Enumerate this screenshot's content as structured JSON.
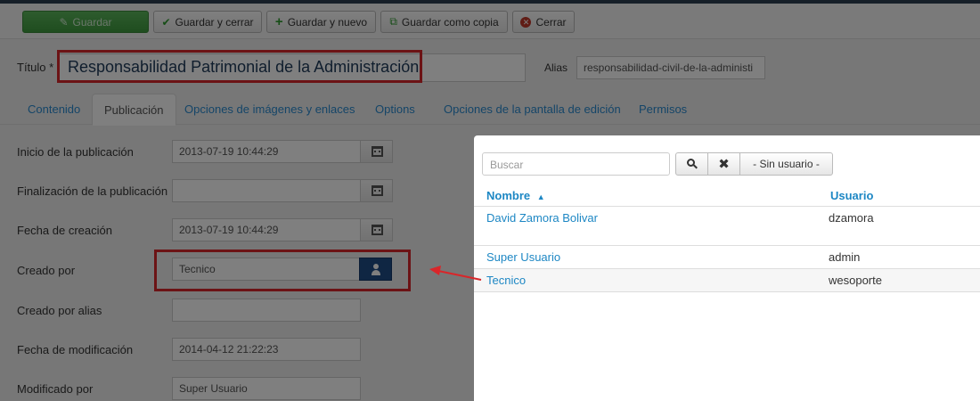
{
  "toolbar": {
    "save": "Guardar",
    "save_close": "Guardar y cerrar",
    "save_new": "Guardar y nuevo",
    "save_copy": "Guardar como copia",
    "close": "Cerrar"
  },
  "title_field": {
    "label": "Título *",
    "value": "Responsabilidad Patrimonial de la Administración."
  },
  "alias_field": {
    "label": "Alias",
    "value": "responsabilidad-civil-de-la-administi"
  },
  "tabs": [
    {
      "label": "Contenido"
    },
    {
      "label": "Publicación"
    },
    {
      "label": "Opciones de imágenes y enlaces"
    },
    {
      "label": "Options"
    },
    {
      "label": "Opciones de la pantalla de edición"
    },
    {
      "label": "Permisos"
    }
  ],
  "form": {
    "publish_up": {
      "label": "Inicio de la publicación",
      "value": "2013-07-19 10:44:29"
    },
    "publish_down": {
      "label": "Finalización de la publicación",
      "value": ""
    },
    "created": {
      "label": "Fecha de creación",
      "value": "2013-07-19 10:44:29"
    },
    "created_by": {
      "label": "Creado por",
      "value": "Tecnico"
    },
    "created_by_alias": {
      "label": "Creado por alias",
      "value": ""
    },
    "modified": {
      "label": "Fecha de modificación",
      "value": "2014-04-12 21:22:23"
    },
    "modified_by": {
      "label": "Modificado por",
      "value": "Super Usuario"
    }
  },
  "modal": {
    "search_placeholder": "Buscar",
    "no_user_button": "- Sin usuario -",
    "clear_symbol": "✖",
    "columns": {
      "name": "Nombre",
      "sort_indicator": "▲",
      "user": "Usuario"
    },
    "rows": [
      {
        "name": "David Zamora Bolivar",
        "username": "dzamora"
      },
      {
        "name": "Super Usuario",
        "username": "admin"
      },
      {
        "name": "Tecnico",
        "username": "wesoporte"
      }
    ]
  },
  "colors": {
    "highlight": "#d9262a",
    "link": "#1d87c4",
    "save_green": "#4aa84a",
    "user_button": "#1f4d86"
  }
}
